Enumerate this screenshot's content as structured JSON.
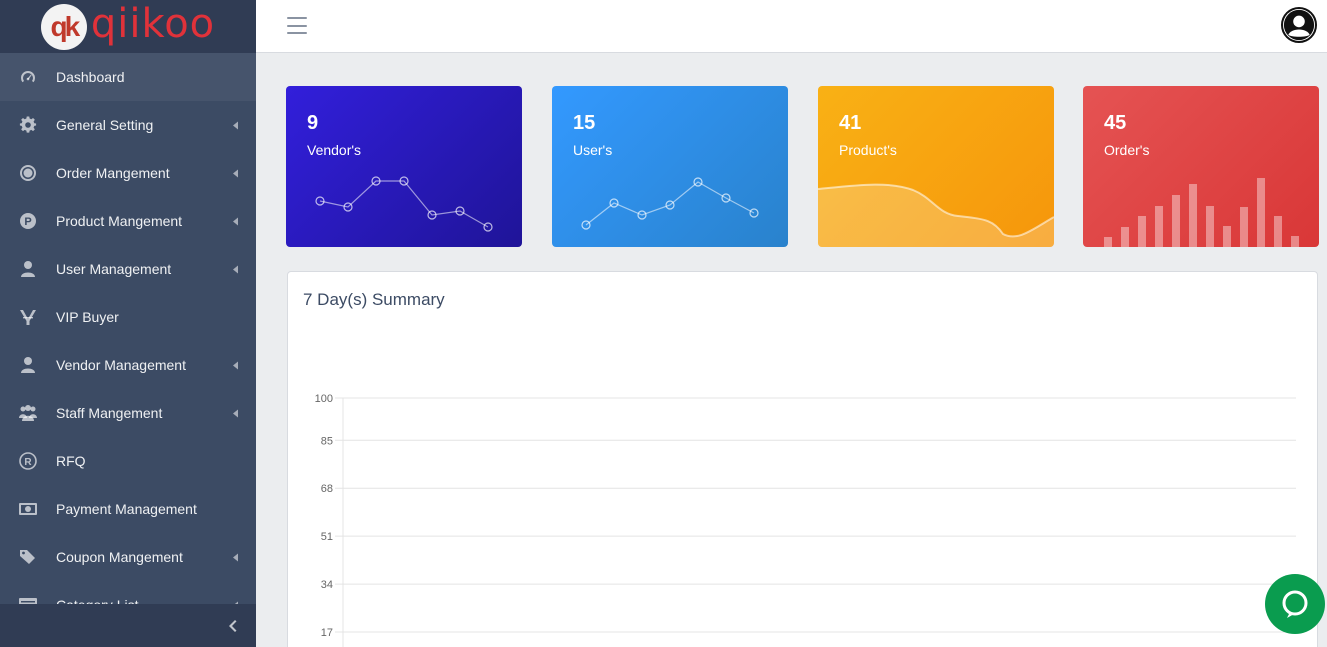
{
  "brand": {
    "logo_mark": "qk",
    "name": "qiikoo"
  },
  "sidebar": {
    "items": [
      {
        "label": "Dashboard",
        "icon": "speedometer-icon",
        "caret": false,
        "active": true
      },
      {
        "label": "General Setting",
        "icon": "gear-icon",
        "caret": true
      },
      {
        "label": "Order Mangement",
        "icon": "target-icon",
        "caret": true
      },
      {
        "label": "Product Mangement",
        "icon": "p-circle-icon",
        "caret": true
      },
      {
        "label": "User Management",
        "icon": "user-icon",
        "caret": true
      },
      {
        "label": "VIP Buyer",
        "icon": "vip-icon",
        "caret": false
      },
      {
        "label": "Vendor Management",
        "icon": "user-icon",
        "caret": true
      },
      {
        "label": "Staff Mangement",
        "icon": "group-icon",
        "caret": true
      },
      {
        "label": "RFQ",
        "icon": "registered-icon",
        "caret": false
      },
      {
        "label": "Payment Management",
        "icon": "money-icon",
        "caret": false
      },
      {
        "label": "Coupon Mangement",
        "icon": "tags-icon",
        "caret": true
      },
      {
        "label": "Category List",
        "icon": "list-icon",
        "caret": true
      }
    ]
  },
  "cards": [
    {
      "value": "9",
      "label": "Vendor's",
      "color": "#321fdb"
    },
    {
      "value": "15",
      "label": "User's",
      "color": "#3399ff"
    },
    {
      "value": "41",
      "label": "Product's",
      "color": "#f9b115"
    },
    {
      "value": "45",
      "label": "Order's",
      "color": "#e55353"
    }
  ],
  "summary": {
    "title": "7 Day(s) Summary"
  },
  "chart_data": {
    "type": "line",
    "title": "7 Day(s) Summary",
    "y_ticks": [
      "100",
      "85",
      "68",
      "51",
      "34",
      "17"
    ],
    "ylim": [
      0,
      100
    ],
    "grid": true,
    "series": []
  }
}
